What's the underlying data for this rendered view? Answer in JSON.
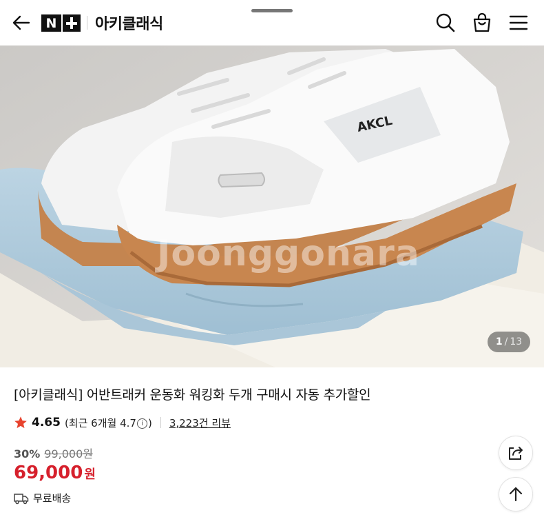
{
  "header": {
    "logo_text": "N+",
    "store_name": "아키클래식"
  },
  "hero": {
    "watermark": "Joonggonara",
    "shoe_brand_print": "AKCL",
    "counter_current": "1",
    "counter_separator": "/",
    "counter_total": "13"
  },
  "product": {
    "title": "[아키클래식] 어반트래커 운동화 워킹화 두개 구매시 자동 추가할인",
    "rating": "4.65",
    "rating_recent_prefix": "(최근 6개월 4.7",
    "rating_recent_suffix": ")",
    "info_glyph": "i",
    "review_count": "3,223건 리뷰",
    "discount": "30%",
    "original_price": "99,000원",
    "sale_price": "69,000",
    "currency": "원",
    "shipping": "무료배송"
  },
  "colors": {
    "sale_price": "#d6202c",
    "star": "#e8432e",
    "text": "#111111"
  },
  "icons": [
    "back-arrow-icon",
    "search-icon",
    "shopping-bag-icon",
    "menu-icon",
    "star-icon",
    "info-icon",
    "truck-icon",
    "share-icon",
    "arrow-up-icon"
  ]
}
